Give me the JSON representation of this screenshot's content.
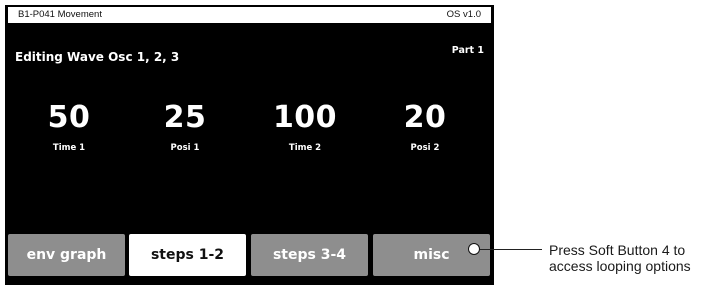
{
  "status_bar": {
    "patch_name": "B1-P041 Movement",
    "os_version": "OS v1.0"
  },
  "header": {
    "title": "Editing Wave Osc 1, 2, 3",
    "part": "Part 1"
  },
  "parameters": [
    {
      "value": "50",
      "label": "Time 1"
    },
    {
      "value": "25",
      "label": "Posi 1"
    },
    {
      "value": "100",
      "label": "Time 2"
    },
    {
      "value": "20",
      "label": "Posi 2"
    }
  ],
  "soft_buttons": [
    {
      "label": "env graph",
      "selected": false
    },
    {
      "label": "steps 1-2",
      "selected": true
    },
    {
      "label": "steps 3-4",
      "selected": false
    },
    {
      "label": "misc",
      "selected": false
    }
  ],
  "callout": {
    "line1": "Press Soft Button 4 to",
    "line2": "access looping options"
  },
  "colors": {
    "screen_background": "#000000",
    "button_inactive": "#8e8e8e",
    "button_active": "#ffffff",
    "text_on_screen": "#ffffff"
  }
}
